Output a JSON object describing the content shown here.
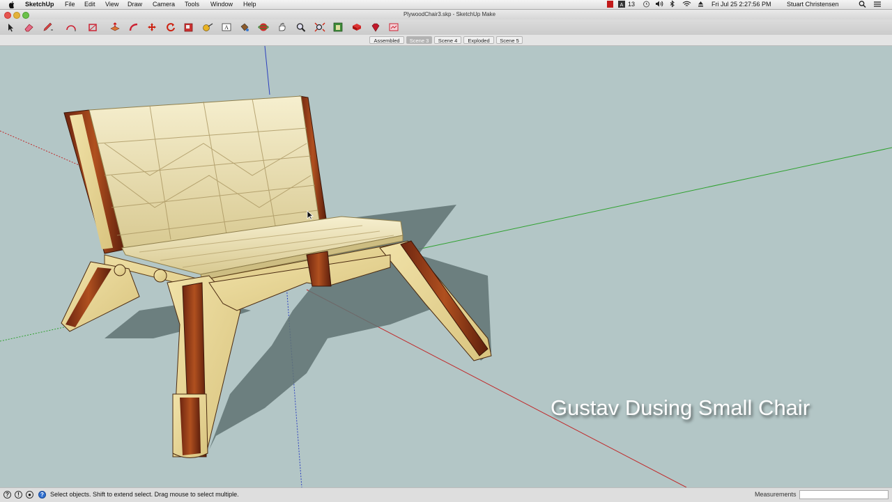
{
  "menubar": {
    "app": "SketchUp",
    "items": [
      "File",
      "Edit",
      "View",
      "Draw",
      "Camera",
      "Tools",
      "Window",
      "Help"
    ],
    "status": {
      "badge": "13",
      "datetime": "Fri Jul 25  2:27:56 PM",
      "user": "Stuart Christensen"
    }
  },
  "window": {
    "title": "PlywoodChair3.skp - SketchUp Make"
  },
  "toolbar": {
    "tools": [
      "select-icon",
      "eraser-icon",
      "pencil-icon",
      "arc-icon",
      "rectangle-icon",
      "push-pull-icon",
      "follow-me-icon",
      "move-icon",
      "rotate-icon",
      "scale-icon",
      "tape-measure-icon",
      "text-icon",
      "paint-bucket-icon",
      "orbit-icon",
      "pan-icon",
      "zoom-icon",
      "zoom-extents-icon",
      "warehouse-icon",
      "extension-icon",
      "ruby-icon",
      "send-to-layout-icon"
    ]
  },
  "scenes": [
    {
      "label": "Assembled",
      "active": false
    },
    {
      "label": "Scene 3",
      "active": true
    },
    {
      "label": "Scene 4",
      "active": false
    },
    {
      "label": "Exploded",
      "active": false
    },
    {
      "label": "Scene 5",
      "active": false
    }
  ],
  "viewport": {
    "caption": "Gustav Dusing Small Chair"
  },
  "statusbar": {
    "hint": "Select objects. Shift to extend select. Drag mouse to select multiple.",
    "measurements_label": "Measurements",
    "measurements_value": ""
  },
  "colors": {
    "sky": "#b3c6c6",
    "red_axis": "#c0292a",
    "green_axis": "#2ea12e",
    "blue_axis": "#2b3fbf",
    "plywood": "#e9d69a",
    "wood_edge": "#8a3214",
    "cushion": "#ece2bb"
  }
}
